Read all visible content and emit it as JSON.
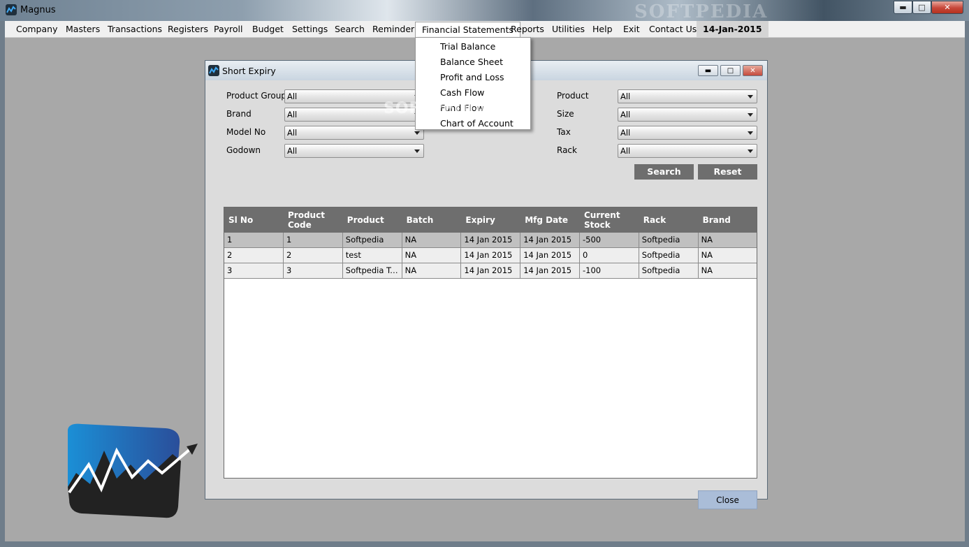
{
  "window": {
    "title": "Magnus",
    "watermark": "SOFTPEDIA"
  },
  "menu": {
    "items": [
      "Company",
      "Masters",
      "Transactions",
      "Registers",
      "Payroll",
      "Budget",
      "Settings",
      "Search",
      "Reminder",
      "Financial Statements",
      "Reports",
      "Utilities",
      "Help",
      "Exit",
      "Contact Us"
    ],
    "date": "14-Jan-2015",
    "open_menu": "Financial Statements",
    "dropdown": [
      "Trial Balance",
      "Balance Sheet",
      "Profit and Loss",
      "Cash Flow",
      "Fund Flow",
      "Chart of Account"
    ]
  },
  "dialog": {
    "title": "Short Expiry",
    "filters_left": [
      {
        "label": "Product Group",
        "value": "All"
      },
      {
        "label": "Brand",
        "value": "All"
      },
      {
        "label": "Model No",
        "value": "All"
      },
      {
        "label": "Godown",
        "value": "All"
      }
    ],
    "filters_right": [
      {
        "label": "Product",
        "value": "All"
      },
      {
        "label": "Size",
        "value": "All"
      },
      {
        "label": "Tax",
        "value": "All"
      },
      {
        "label": "Rack",
        "value": "All"
      }
    ],
    "search_label": "Search",
    "reset_label": "Reset",
    "close_label": "Close",
    "table": {
      "columns": [
        "Sl No",
        "Product Code",
        "Product",
        "Batch",
        "Expiry",
        "Mfg Date",
        "Current Stock",
        "Rack",
        "Brand"
      ],
      "rows": [
        [
          "1",
          "1",
          "Softpedia",
          "NA",
          "14 Jan 2015",
          "14 Jan 2015",
          "-500",
          "Softpedia",
          "NA"
        ],
        [
          "2",
          "2",
          "test",
          "NA",
          "14 Jan 2015",
          "14 Jan 2015",
          "0",
          "Softpedia",
          "NA"
        ],
        [
          "3",
          "3",
          "Softpedia Tes...",
          "NA",
          "14 Jan 2015",
          "14 Jan 2015",
          "-100",
          "Softpedia",
          "NA"
        ]
      ]
    }
  },
  "colors": {
    "header": "#6e6e6e",
    "menu_bg": "#f0f0f0",
    "workspace": "#a8a8a8",
    "close_btn": "#aabdd8"
  }
}
